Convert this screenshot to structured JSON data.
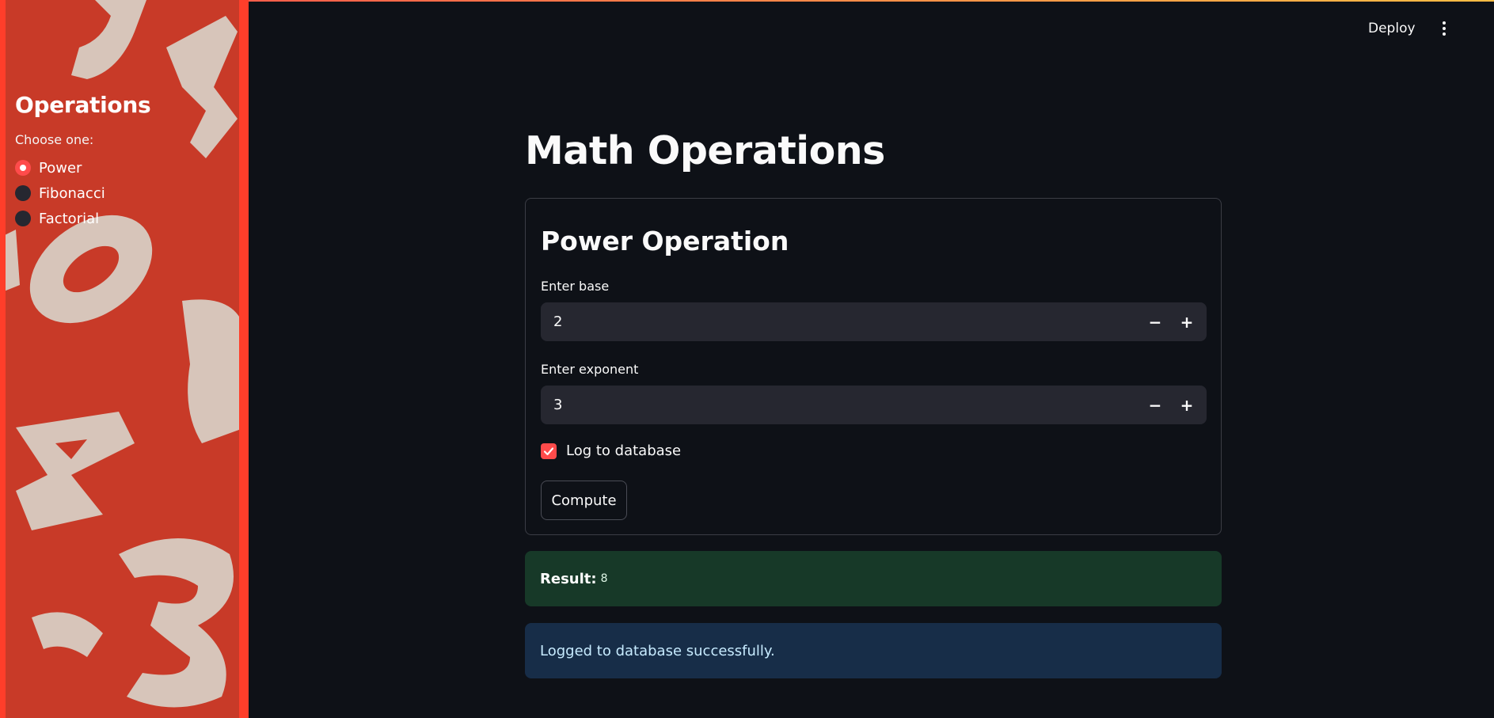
{
  "header": {
    "deploy_label": "Deploy",
    "menu_icon": "more-vertical-icon"
  },
  "sidebar": {
    "title": "Operations",
    "radio_label": "Choose one:",
    "options": [
      {
        "label": "Power",
        "selected": true
      },
      {
        "label": "Fibonacci",
        "selected": false
      },
      {
        "label": "Factorial",
        "selected": false
      }
    ],
    "background_color": "#c83a28"
  },
  "main": {
    "title": "Math Operations",
    "card": {
      "title": "Power Operation",
      "base": {
        "label": "Enter base",
        "value": "2"
      },
      "exponent": {
        "label": "Enter exponent",
        "value": "3"
      },
      "decrement_symbol": "−",
      "increment_symbol": "+",
      "log_checkbox": {
        "label": "Log to database",
        "checked": true
      },
      "compute_label": "Compute"
    },
    "result": {
      "label": "Result:",
      "value": "8"
    },
    "info_message": "Logged to database successfully."
  },
  "colors": {
    "accent": "#ff4b4b",
    "background": "#0e1117",
    "input_bg": "#262730",
    "success_bg": "#173928",
    "info_bg": "#172d48"
  }
}
